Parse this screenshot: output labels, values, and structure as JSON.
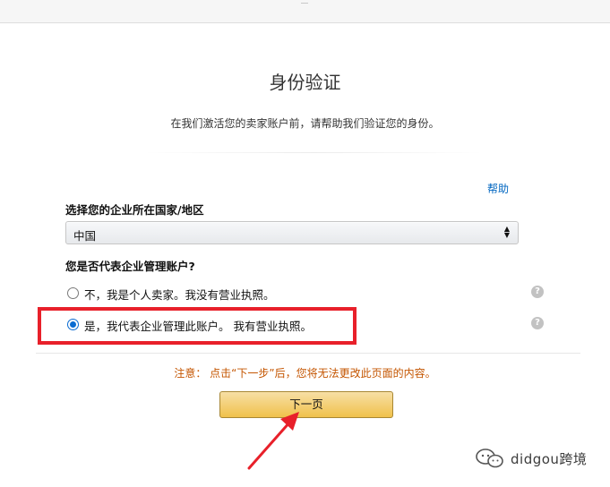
{
  "page": {
    "title": "身份验证",
    "subtitle": "在我们激活您的卖家账户前，请帮助我们验证您的身份。",
    "help_link": "帮助"
  },
  "country": {
    "label": "选择您的企业所在国家/地区",
    "selected_value": "中国"
  },
  "business": {
    "question": "您是否代表企业管理账户?",
    "options": [
      {
        "label": "不，我是个人卖家。我没有营业执照。",
        "selected": false
      },
      {
        "label": "是，我代表企业管理此账户。 我有营业执照。",
        "selected": true
      }
    ],
    "help_glyph": "?"
  },
  "notice": "注意： 点击“下一步”后，您将无法更改此页面的内容。",
  "next_button": "下一页",
  "watermark": "didgou跨境",
  "colors": {
    "primary_button": "#f0c14b",
    "link": "#0066c0",
    "warning_text": "#c45500",
    "annotation_red": "#e8202a",
    "radio_selected": "#0a6bd1"
  },
  "icons": {
    "help": "question-circle-icon",
    "select": "chevron-updown-icon",
    "annotation": "pointer-arrow-icon",
    "watermark": "wechat-icon"
  }
}
